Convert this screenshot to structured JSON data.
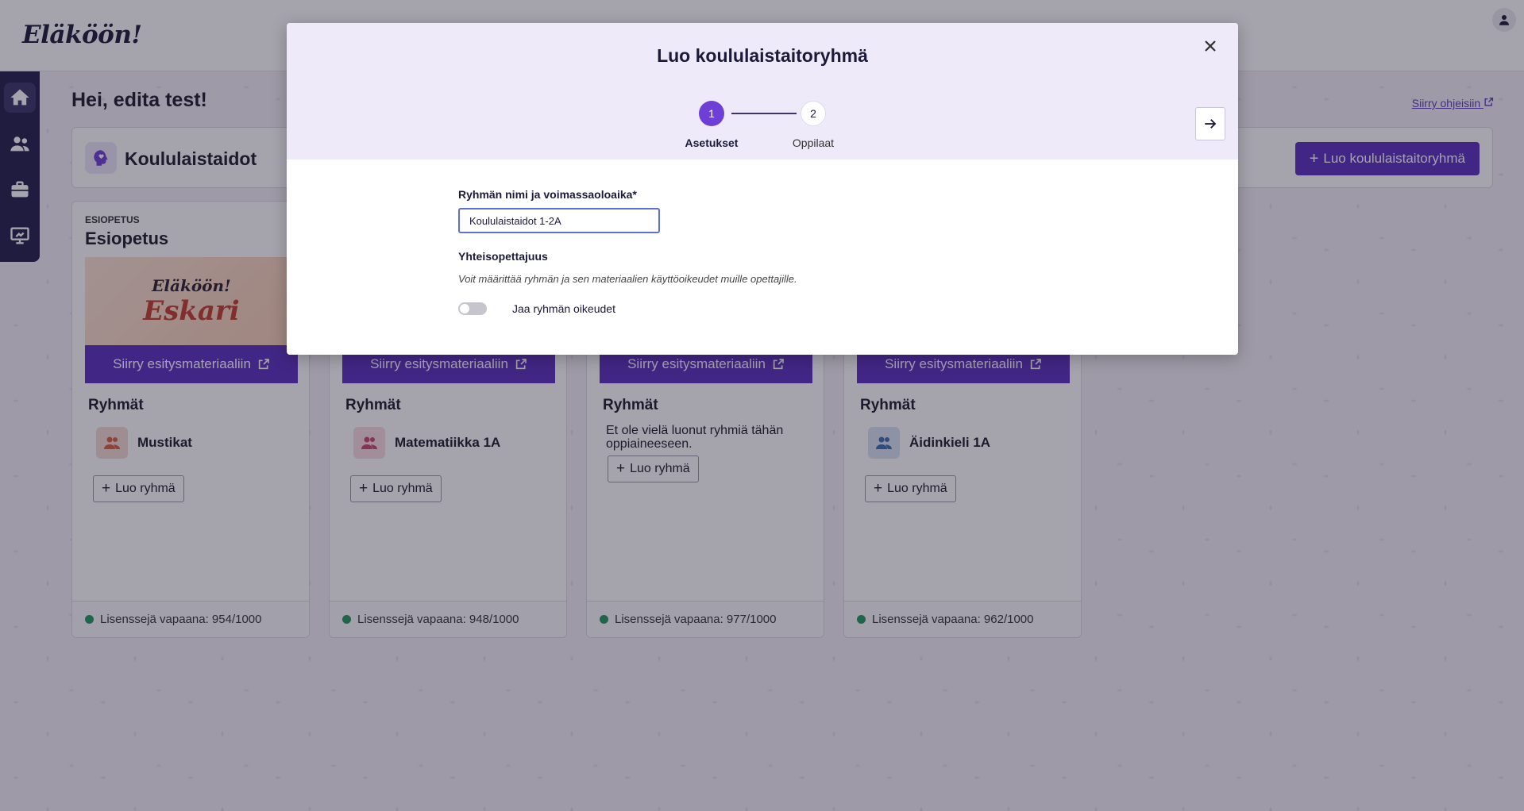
{
  "header": {
    "logo": "Eläköön!"
  },
  "sidebar": {
    "items": [
      "home-icon",
      "users-icon",
      "briefcase-icon",
      "presentation-icon"
    ]
  },
  "main": {
    "greeting": "Hei, edita test!",
    "help_link": "Siirry ohjeisiin",
    "section": {
      "title": "Koululaistaidot",
      "create_button": "Luo koululaistaitoryhmä"
    },
    "cards": [
      {
        "label": "ESIOPETUS",
        "title": "Esiopetus",
        "image_line1": "Eläköön!",
        "image_line2": "Eskari",
        "present_button": "Siirry esitysmateriaaliin",
        "groups_heading": "Ryhmät",
        "group": "Mustikat",
        "add_group": "Luo ryhmä",
        "license": "Lisenssejä vapaana: 954/1000",
        "avatar_color": "#f6ddd2",
        "avatar_icon_color": "#d9603e"
      },
      {
        "present_button": "Siirry esitysmateriaaliin",
        "groups_heading": "Ryhmät",
        "group": "Matematiikka 1A",
        "add_group": "Luo ryhmä",
        "license": "Lisenssejä vapaana: 948/1000",
        "avatar_color": "#f8dde2",
        "avatar_icon_color": "#c9486a"
      },
      {
        "present_button": "Siirry esitysmateriaaliin",
        "groups_heading": "Ryhmät",
        "empty_text": "Et ole vielä luonut ryhmiä tähän oppiaineeseen.",
        "add_group": "Luo ryhmä",
        "license": "Lisenssejä vapaana: 977/1000"
      },
      {
        "present_button": "Siirry esitysmateriaaliin",
        "groups_heading": "Ryhmät",
        "group": "Äidinkieli 1A",
        "add_group": "Luo ryhmä",
        "license": "Lisenssejä vapaana: 962/1000",
        "avatar_color": "#d7e4f3",
        "avatar_icon_color": "#3b6fb0"
      }
    ]
  },
  "modal": {
    "title": "Luo koululaistaitoryhmä",
    "steps": [
      {
        "number": "1",
        "label": "Asetukset"
      },
      {
        "number": "2",
        "label": "Oppilaat"
      }
    ],
    "name_label": "Ryhmän nimi ja voimassaoloaika*",
    "name_value": "Koululaistaidot 1-2A",
    "coteach_label": "Yhteisopettajuus",
    "coteach_desc": "Voit määrittää ryhmän ja sen materiaalien käyttöoikeudet muille opettajille.",
    "toggle_label": "Jaa ryhmän oikeudet"
  },
  "colors": {
    "accent": "#5b2fbf",
    "sidebar": "#221e4a",
    "modal_header": "#efeafa",
    "license_dot": "#1f9a5b"
  }
}
